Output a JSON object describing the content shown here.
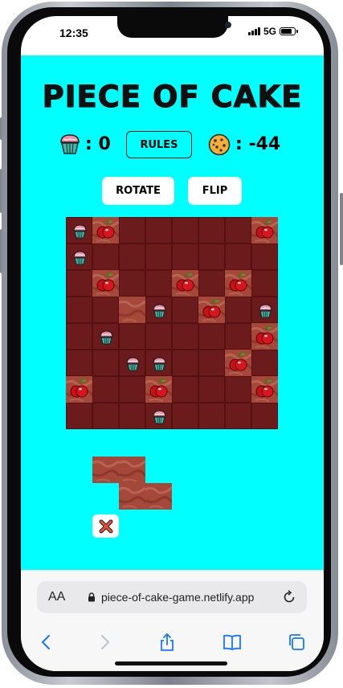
{
  "status": {
    "time": "12:35",
    "network": "5G"
  },
  "game": {
    "title": "PIECE OF CAKE",
    "cupcake_score": ": 0",
    "cookie_score": ": -44",
    "rules_label": "RULES",
    "rotate_label": "ROTATE",
    "flip_label": "FLIP"
  },
  "board": {
    "size": 8,
    "colors": {
      "base": "#6b1b1b",
      "grid": "#56100f",
      "cake": "#a5483a",
      "cake_light": "#c27a65"
    },
    "cells": [
      {
        "r": 0,
        "c": 0,
        "t": "cupcake"
      },
      {
        "r": 0,
        "c": 1,
        "t": "cake-cherry"
      },
      {
        "r": 0,
        "c": 7,
        "t": "cake-cherry"
      },
      {
        "r": 1,
        "c": 0,
        "t": "cupcake"
      },
      {
        "r": 2,
        "c": 1,
        "t": "cake-cherry"
      },
      {
        "r": 2,
        "c": 4,
        "t": "cake-cherry"
      },
      {
        "r": 2,
        "c": 6,
        "t": "cake-cherry"
      },
      {
        "r": 3,
        "c": 2,
        "t": "cake"
      },
      {
        "r": 3,
        "c": 3,
        "t": "cupcake"
      },
      {
        "r": 3,
        "c": 5,
        "t": "cake-cherry"
      },
      {
        "r": 3,
        "c": 7,
        "t": "cupcake"
      },
      {
        "r": 4,
        "c": 1,
        "t": "cupcake"
      },
      {
        "r": 4,
        "c": 7,
        "t": "cake-cherry"
      },
      {
        "r": 5,
        "c": 2,
        "t": "cupcake"
      },
      {
        "r": 5,
        "c": 3,
        "t": "cupcake"
      },
      {
        "r": 5,
        "c": 6,
        "t": "cake-cherry"
      },
      {
        "r": 6,
        "c": 0,
        "t": "cake-cherry"
      },
      {
        "r": 6,
        "c": 3,
        "t": "cake-cherry"
      },
      {
        "r": 6,
        "c": 7,
        "t": "cake-cherry"
      },
      {
        "r": 7,
        "c": 3,
        "t": "cupcake"
      }
    ]
  },
  "current_piece": {
    "cells": [
      {
        "r": 0,
        "c": 0
      },
      {
        "r": 0,
        "c": 1
      },
      {
        "r": 1,
        "c": 1
      },
      {
        "r": 1,
        "c": 2
      }
    ]
  },
  "browser": {
    "aa_label": "AA",
    "url": "piece-of-cake-game.netlify.app"
  }
}
